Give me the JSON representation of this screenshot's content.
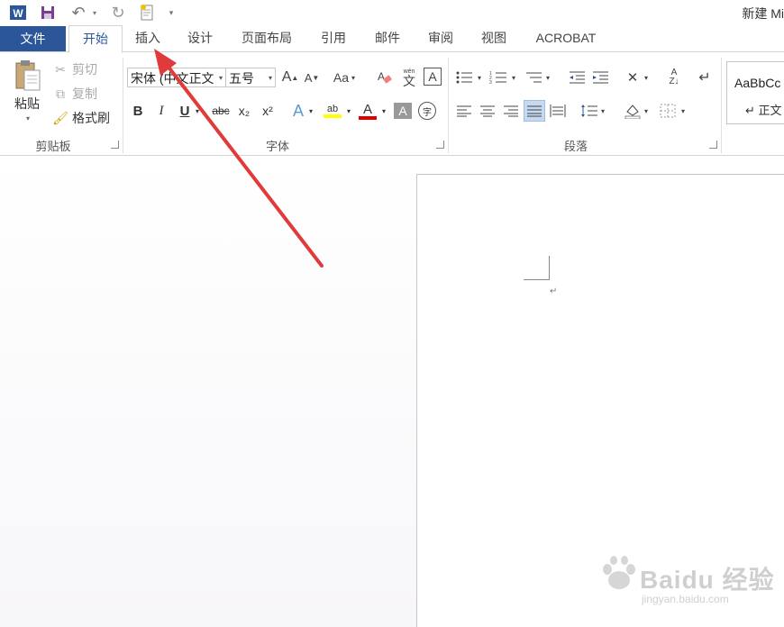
{
  "title_bar": {
    "title": "新建 Mi",
    "quick_access": [
      "word-logo-icon",
      "save-icon",
      "undo-icon",
      "redo-icon",
      "new-doc-icon",
      "customize-icon"
    ]
  },
  "tabs": [
    {
      "label": "文件",
      "active": false
    },
    {
      "label": "开始",
      "active": true
    },
    {
      "label": "插入",
      "active": false
    },
    {
      "label": "设计",
      "active": false
    },
    {
      "label": "页面布局",
      "active": false
    },
    {
      "label": "引用",
      "active": false
    },
    {
      "label": "邮件",
      "active": false
    },
    {
      "label": "审阅",
      "active": false
    },
    {
      "label": "视图",
      "active": false
    },
    {
      "label": "ACROBAT",
      "active": false
    }
  ],
  "clipboard": {
    "paste_label": "粘贴",
    "cut_label": "剪切",
    "copy_label": "复制",
    "format_painter_label": "格式刷",
    "group_label": "剪贴板"
  },
  "font": {
    "font_name": "宋体 (中文正文",
    "font_size": "五号",
    "case_label": "Aa",
    "phonetic_top": "wén",
    "phonetic_bottom": "文",
    "bold": "B",
    "italic": "I",
    "underline": "U",
    "strikethrough": "abc",
    "subscript": "x₂",
    "superscript": "x²",
    "grow": "A",
    "shrink": "A",
    "text_effects": "A",
    "highlight": "ab",
    "font_color": "A",
    "char_shading": "A",
    "enclose": "字",
    "border_char": "A",
    "group_label": "字体"
  },
  "paragraph": {
    "group_label": "段落"
  },
  "styles": {
    "sample": "AaBbCc",
    "name": "↵ 正文"
  },
  "document": {
    "paragraph_mark": "↵"
  },
  "watermark": {
    "brand": "Baidu 经验",
    "url": "jingyan.baidu.com"
  },
  "colors": {
    "accent": "#2b579a",
    "arrow": "#e03a3a",
    "highlight_yellow": "#ffff00",
    "font_red": "#e00000"
  }
}
